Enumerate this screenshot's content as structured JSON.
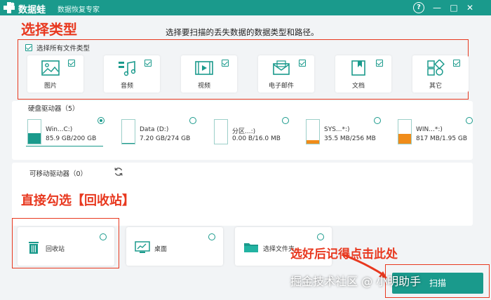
{
  "app": {
    "name": "数据蛙",
    "subtitle": "数据恢复专家",
    "brand_color": "#1a9a8c",
    "annotation_color": "#e8381f"
  },
  "titlebar": {
    "help_icon": "?",
    "minimize_icon": "—",
    "maximize_icon": "□",
    "close_icon": "✕"
  },
  "annotations": {
    "select_type": "选择类型",
    "check_recycle": "直接勾选【回收站】",
    "click_here": "选好后记得点击此处"
  },
  "page": {
    "subtitle": "选择要扫描的丢失数据的数据类型和路径。"
  },
  "file_types": {
    "select_all_label": "选择所有文件类型",
    "select_all_checked": true,
    "items": [
      {
        "label": "图片",
        "icon": "image-icon",
        "checked": true
      },
      {
        "label": "音频",
        "icon": "music-icon",
        "checked": true
      },
      {
        "label": "视频",
        "icon": "video-icon",
        "checked": true
      },
      {
        "label": "电子邮件",
        "icon": "email-icon",
        "checked": true
      },
      {
        "label": "文档",
        "icon": "document-icon",
        "checked": true
      },
      {
        "label": "其它",
        "icon": "other-icon",
        "checked": true
      }
    ]
  },
  "disks": {
    "header": "硬盘驱动器（5）",
    "items": [
      {
        "name": "Win...C:)",
        "size": "85.9 GB/200 GB",
        "selected": true,
        "fill_fraction": 0.43,
        "fill_color": "#1a9a8c"
      },
      {
        "name": "Data (D:)",
        "size": "7.20 GB/274 GB",
        "selected": false,
        "fill_fraction": 0.03,
        "fill_color": "#1a9a8c"
      },
      {
        "name": "分区...:)",
        "size": "0.00  B/16.0 MB",
        "selected": false,
        "fill_fraction": 0.0,
        "fill_color": "#f08c1a"
      },
      {
        "name": "SYS...*:)",
        "size": "35.5 MB/256 MB",
        "selected": false,
        "fill_fraction": 0.14,
        "fill_color": "#f08c1a"
      },
      {
        "name": "WIN...*:)",
        "size": "817 MB/1.95 GB",
        "selected": false,
        "fill_fraction": 0.42,
        "fill_color": "#f08c1a"
      }
    ]
  },
  "removable": {
    "header": "可移动驱动器（0）"
  },
  "locations": {
    "items": [
      {
        "label": "回收站",
        "icon": "trash-icon"
      },
      {
        "label": "桌面",
        "icon": "desktop-icon"
      },
      {
        "label": "选择文件夹",
        "icon": "folder-icon"
      }
    ]
  },
  "watermark": "掘金技术社区 @ 小明助手",
  "scan_button": {
    "label": "扫描"
  }
}
